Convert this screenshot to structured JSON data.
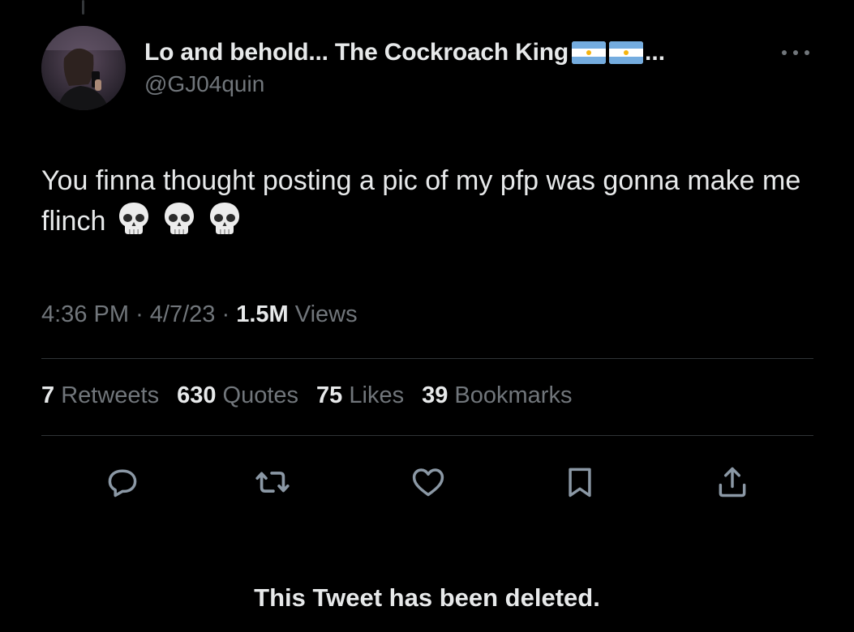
{
  "author": {
    "display_name": "Lo and behold... The Cockroach King",
    "name_truncation": "...",
    "handle": "@GJ04quin",
    "flags": [
      "argentina-flag-icon",
      "argentina-flag-icon"
    ]
  },
  "tweet": {
    "text": "You finna thought posting a pic of my pfp was gonna make me flinch",
    "emoji": [
      "skull-emoji",
      "skull-emoji",
      "skull-emoji"
    ]
  },
  "meta": {
    "time": "4:36 PM",
    "separator": "·",
    "date": "4/7/23",
    "views_count": "1.5M",
    "views_label": "Views"
  },
  "stats": {
    "retweets_count": "7",
    "retweets_label": "Retweets",
    "quotes_count": "630",
    "quotes_label": "Quotes",
    "likes_count": "75",
    "likes_label": "Likes",
    "bookmarks_count": "39",
    "bookmarks_label": "Bookmarks"
  },
  "actions": [
    "reply-icon",
    "retweet-icon",
    "like-icon",
    "bookmark-icon",
    "share-icon"
  ],
  "footer": {
    "deleted_notice": "This Tweet has been deleted."
  },
  "colors": {
    "background": "#000000",
    "primary_text": "#e7e9ea",
    "secondary_text": "#71767b",
    "divider": "#2f3336"
  }
}
